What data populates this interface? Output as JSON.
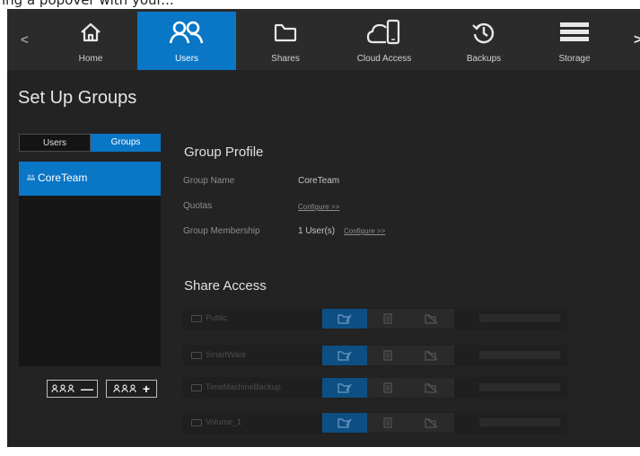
{
  "caption": "ing a popover with your...",
  "nav": {
    "tabs": [
      {
        "label": "Home",
        "icon": "home-icon",
        "active": false
      },
      {
        "label": "Users",
        "icon": "users-icon",
        "active": true
      },
      {
        "label": "Shares",
        "icon": "folder-icon",
        "active": false
      },
      {
        "label": "Cloud Access",
        "icon": "cloud-device-icon",
        "active": false
      },
      {
        "label": "Backups",
        "icon": "history-icon",
        "active": false
      },
      {
        "label": "Storage",
        "icon": "storage-icon",
        "active": false
      }
    ]
  },
  "page_title": "Set Up Groups",
  "toggle": {
    "users": "Users",
    "groups": "Groups",
    "selected": "Groups"
  },
  "groups": [
    {
      "name": "CoreTeam",
      "selected": true
    }
  ],
  "group_profile": {
    "title": "Group Profile",
    "name_label": "Group Name",
    "name_value": "CoreTeam",
    "quotas_label": "Quotas",
    "quotas_link": "Configure >>",
    "membership_label": "Group Membership",
    "membership_value": "1 User(s)",
    "membership_link": "Configure >>"
  },
  "share_access": {
    "title": "Share Access",
    "shares": [
      {
        "name": "Public"
      },
      {
        "name": "SmartWare"
      },
      {
        "name": "TimeMachineBackup"
      },
      {
        "name": "Volume_1"
      }
    ]
  },
  "colors": {
    "accent": "#0a76c6",
    "background": "#232323",
    "nav": "#2b2b2b"
  }
}
